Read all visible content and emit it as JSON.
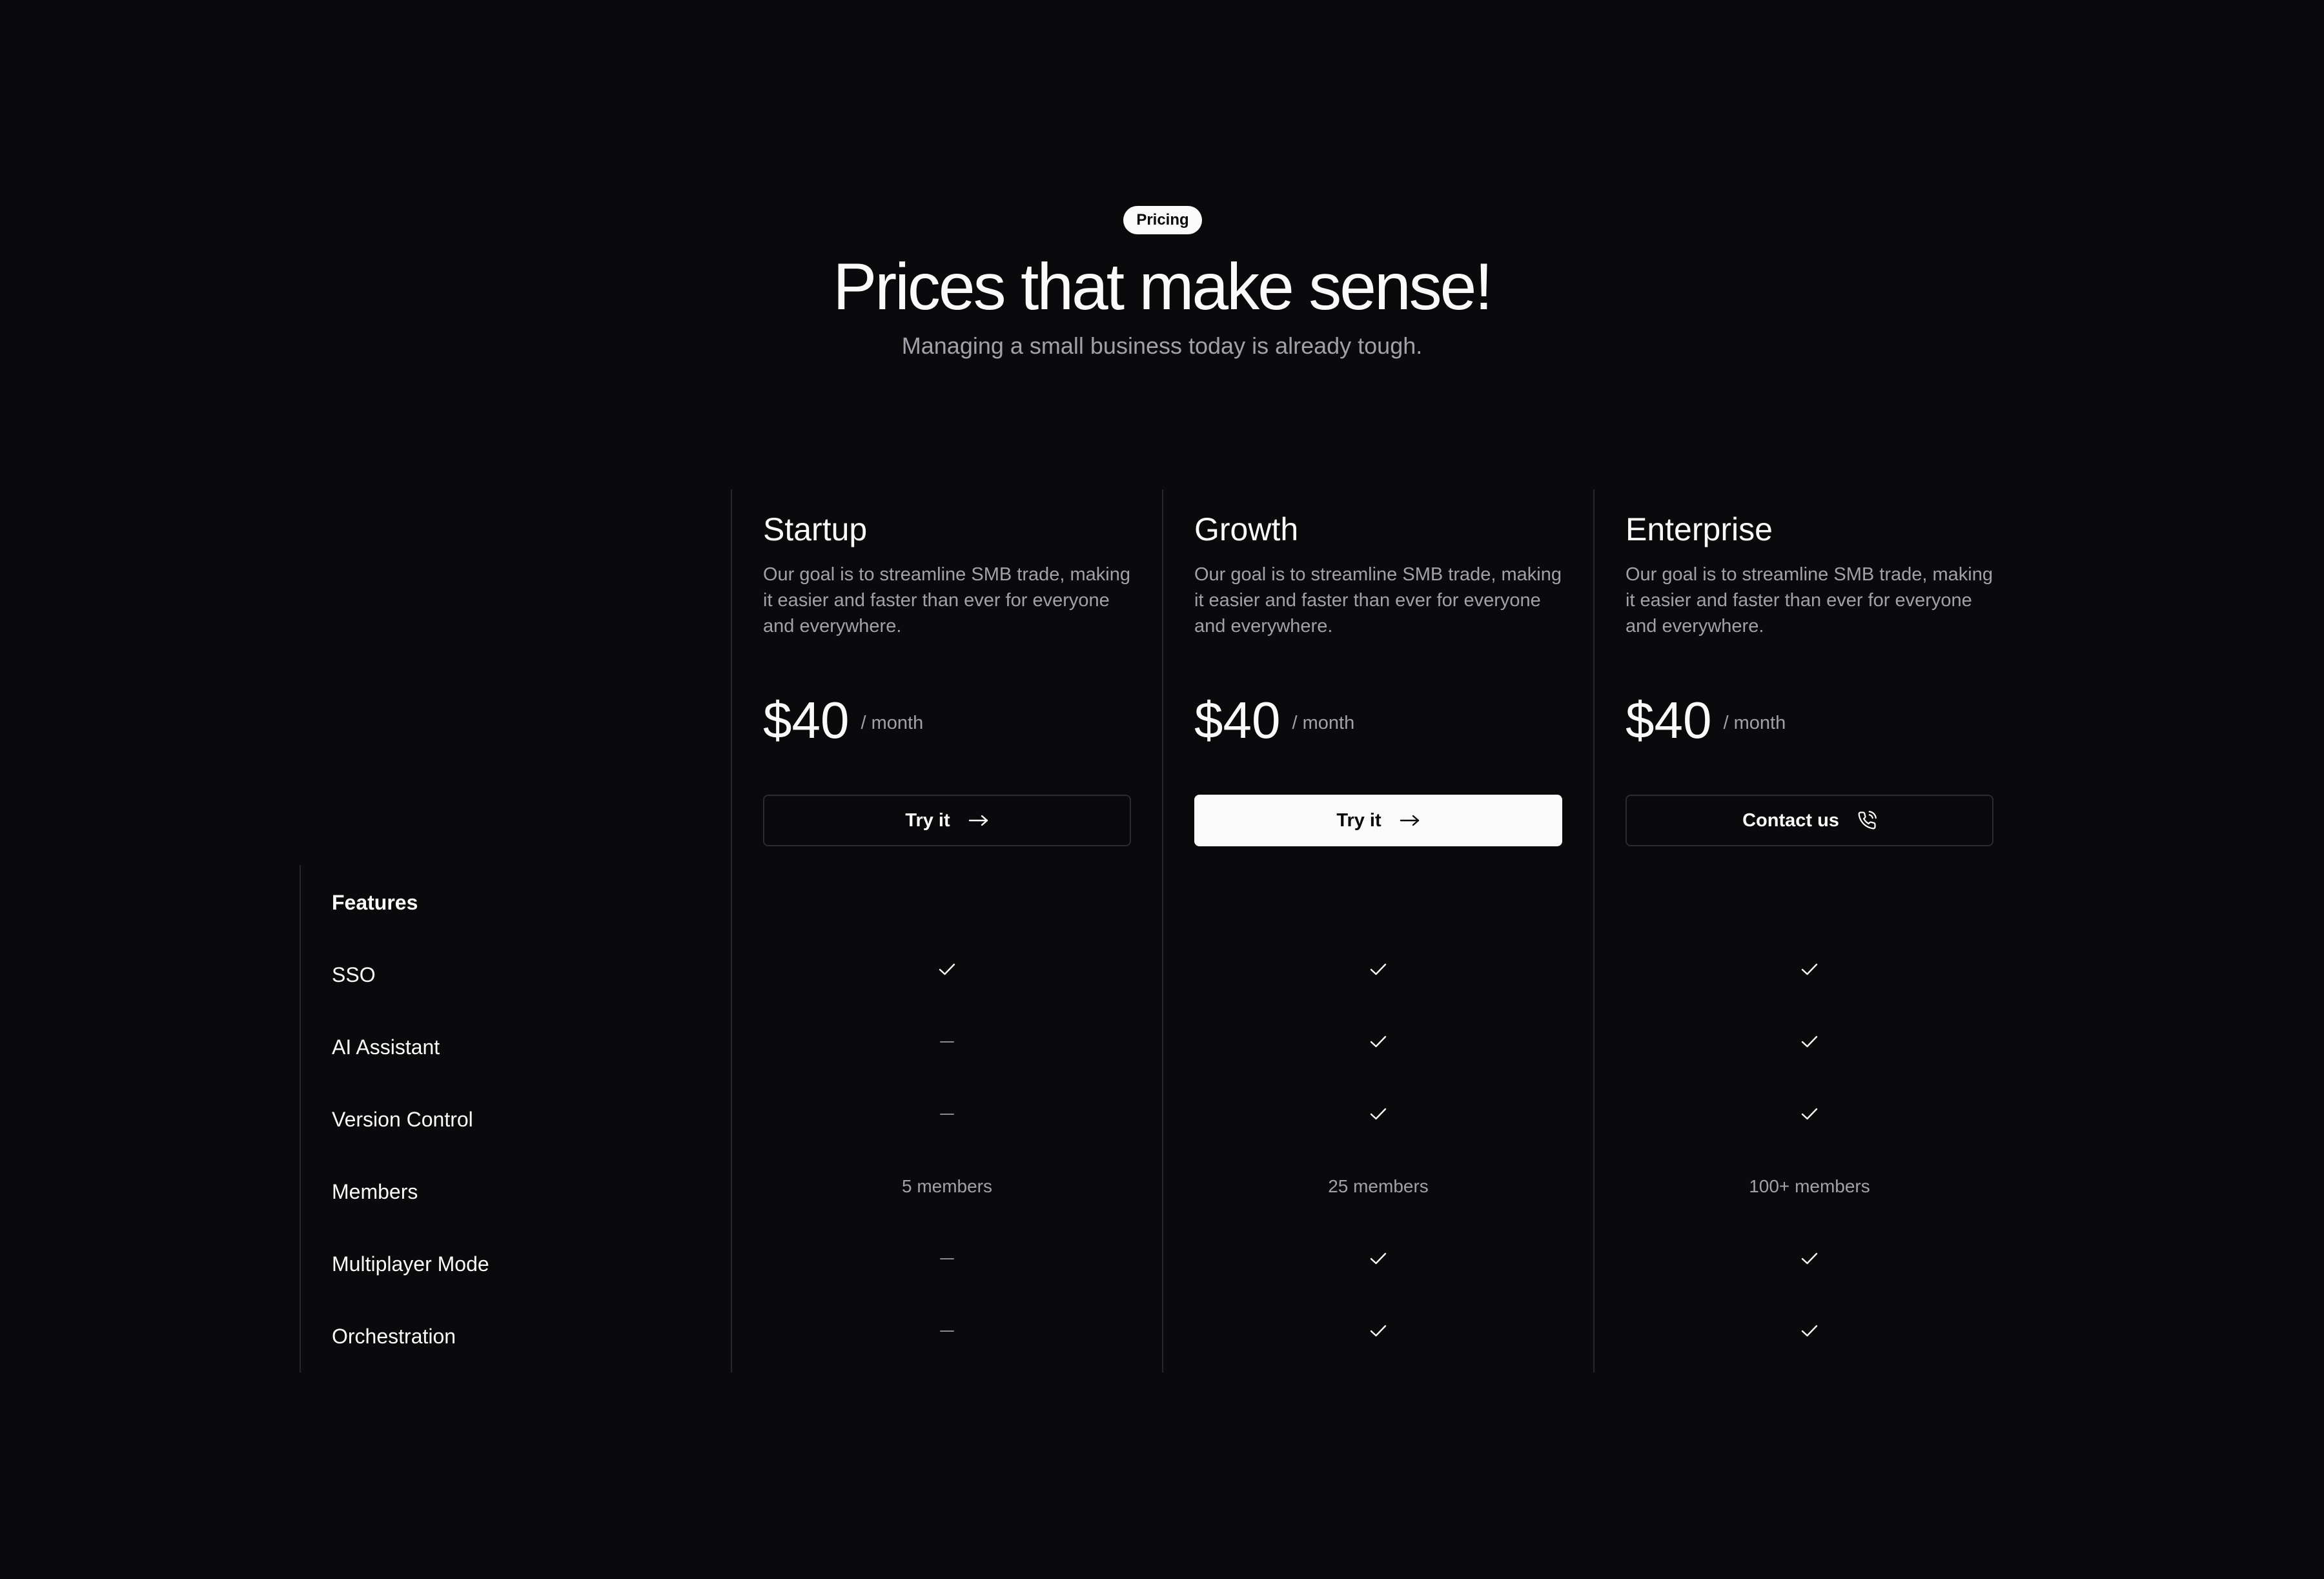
{
  "header": {
    "badge": "Pricing",
    "title": "Prices that make sense!",
    "subtitle": "Managing a small business today is already tough."
  },
  "plans": [
    {
      "name": "Startup",
      "description": "Our goal is to streamline SMB trade, making it easier and faster than ever for everyone and everywhere.",
      "price": "$40",
      "period": "/ month",
      "button_label": "Try it",
      "button_icon": "arrow-right-icon",
      "button_style": "outline"
    },
    {
      "name": "Growth",
      "description": "Our goal is to streamline SMB trade, making it easier and faster than ever for everyone and everywhere.",
      "price": "$40",
      "period": "/ month",
      "button_label": "Try it",
      "button_icon": "arrow-right-icon",
      "button_style": "filled"
    },
    {
      "name": "Enterprise",
      "description": "Our goal is to streamline SMB trade, making it easier and faster than ever for everyone and everywhere.",
      "price": "$40",
      "period": "/ month",
      "button_label": "Contact us",
      "button_icon": "phone-call-icon",
      "button_style": "outline"
    }
  ],
  "features": {
    "heading": "Features",
    "rows": [
      {
        "label": "SSO",
        "values": [
          "check",
          "check",
          "check"
        ]
      },
      {
        "label": "AI Assistant",
        "values": [
          "dash",
          "check",
          "check"
        ]
      },
      {
        "label": "Version Control",
        "values": [
          "dash",
          "check",
          "check"
        ]
      },
      {
        "label": "Members",
        "values": [
          "5 members",
          "25 members",
          "100+ members"
        ]
      },
      {
        "label": "Multiplayer Mode",
        "values": [
          "dash",
          "check",
          "check"
        ]
      },
      {
        "label": "Orchestration",
        "values": [
          "dash",
          "check",
          "check"
        ]
      }
    ]
  },
  "colors": {
    "background": "#0a0a0c",
    "text": "#fafafa",
    "muted": "#a1a1aa",
    "border": "#26262b"
  }
}
